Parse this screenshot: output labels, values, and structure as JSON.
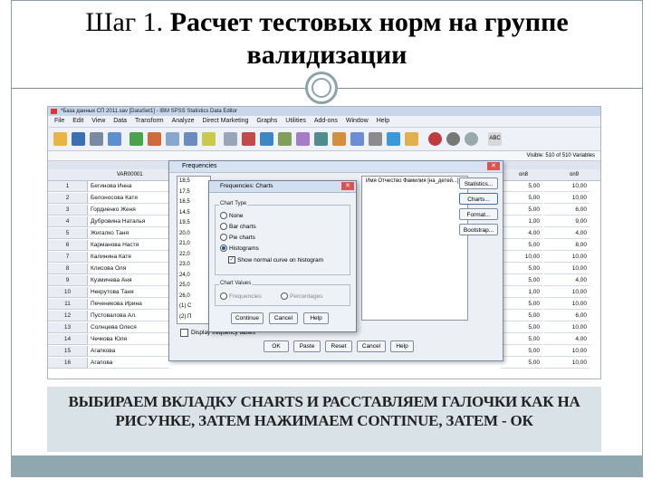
{
  "slide": {
    "title_prefix": "Шаг 1.",
    "title_rest": " Расчет тестовых норм на группе",
    "title_line2": "валидизации",
    "caption": "ВЫБИРАЕМ ВКЛАДКУ CHARTS И РАССТАВЛЯЕМ ГАЛОЧКИ КАК НА РИСУНКЕ, ЗАТЕМ НАЖИМАЕМ CONTINUE, ЗАТЕМ - ОК"
  },
  "app": {
    "window_title": "*База данных СП 2011.sav [DataSet1] - IBM SPSS Statistics Data Editor",
    "menu": [
      "File",
      "Edit",
      "View",
      "Data",
      "Transform",
      "Analyze",
      "Direct Marketing",
      "Graphs",
      "Utilities",
      "Add-ons",
      "Window",
      "Help"
    ],
    "visible_vars": "Visible: 510 of 510 Variables",
    "columns": {
      "var": "VAR00001",
      "c1": "on8",
      "c2": "on9"
    }
  },
  "rows": [
    {
      "n": "1",
      "name": "Бегинова Инна",
      "v1": "5,00",
      "v2": "10,00"
    },
    {
      "n": "2",
      "name": "Белоносова Катя",
      "v1": "5,00",
      "v2": "10,00"
    },
    {
      "n": "3",
      "name": "Гордиенко Женя",
      "v1": "5,00",
      "v2": "6,00"
    },
    {
      "n": "4",
      "name": "Дубровина Наталья",
      "v1": "1,00",
      "v2": "9,00"
    },
    {
      "n": "5",
      "name": "Жигалко Таня",
      "v1": "4,00",
      "v2": "4,00"
    },
    {
      "n": "6",
      "name": "Карманова Настя",
      "v1": "5,00",
      "v2": "8,00"
    },
    {
      "n": "7",
      "name": "Калинина Катя",
      "v1": "10,00",
      "v2": "10,00"
    },
    {
      "n": "8",
      "name": "Клисова Оля",
      "v1": "5,00",
      "v2": "10,00"
    },
    {
      "n": "9",
      "name": "Кузмичева Аня",
      "v1": "5,00",
      "v2": "4,00"
    },
    {
      "n": "10",
      "name": "Некрутова Таня",
      "v1": "1,00",
      "v2": "10,00"
    },
    {
      "n": "11",
      "name": "Печеникова Ирина",
      "v1": "5,00",
      "v2": "10,00"
    },
    {
      "n": "12",
      "name": "Пустовалова Ал.",
      "v1": "5,00",
      "v2": "6,00"
    },
    {
      "n": "13",
      "name": "Солнцева Олеся",
      "v1": "5,00",
      "v2": "10,00"
    },
    {
      "n": "14",
      "name": "Чечкова Юля",
      "v1": "5,00",
      "v2": "4,00"
    },
    {
      "n": "15",
      "name": "Агапкова",
      "v1": "5,00",
      "v2": "10,00"
    },
    {
      "n": "16",
      "name": "Агапова",
      "v1": "5,00",
      "v2": "10,00"
    }
  ],
  "freq_dialog": {
    "title": "Frequencies",
    "list_items": [
      "18,5",
      "17,5",
      "16,5",
      "14,5",
      "19,5",
      "20,0",
      "21,0",
      "22,0",
      "23,0",
      "24,0",
      "25,0",
      "26,0",
      "(1) С",
      "(2) П",
      "(7) В"
    ],
    "selected_var": "Имя Отчество Фамилия [на_детей...]",
    "side_buttons": [
      "Statistics...",
      "Charts...",
      "Format...",
      "Bootstrap..."
    ],
    "display_label": "Display frequency tables",
    "buttons": [
      "OK",
      "Paste",
      "Reset",
      "Cancel",
      "Help"
    ]
  },
  "charts_dialog": {
    "title": "Frequencies: Charts",
    "chart_type_label": "Chart Type",
    "options": [
      "None",
      "Bar charts",
      "Pie charts",
      "Histograms"
    ],
    "normal_curve_label": "Show normal curve on histogram",
    "chart_values_label": "Chart Values",
    "values_options": [
      "Frequencies",
      "Percentages"
    ],
    "buttons": [
      "Continue",
      "Cancel",
      "Help"
    ]
  }
}
